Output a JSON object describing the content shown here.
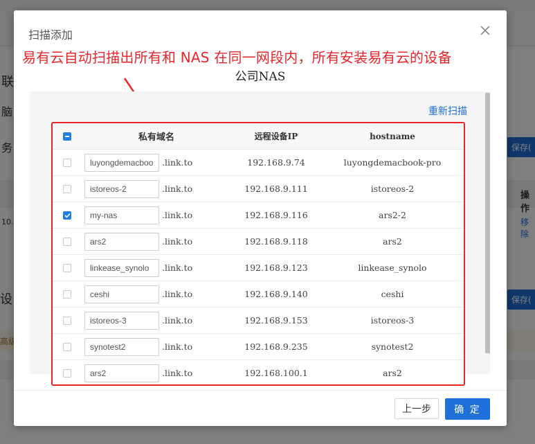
{
  "background": {
    "heading_partial": "联",
    "label_partial_1": "脑",
    "label_partial_2": "务：",
    "save_button_partial": "保存(",
    "col_header_partial": "操作",
    "row_link_partial": "移除",
    "row_ip_partial": "10.",
    "section_partial": "设（",
    "advanced_partial": "高级"
  },
  "modal": {
    "title": "扫描添加",
    "annotation": "易有云自动扫描出所有和 NAS 在同一网段内，所有安装易有云的设备",
    "device_name": "公司NAS",
    "rescan_label": "重新扫描",
    "columns": {
      "domain": "私有域名",
      "ip": "远程设备IP",
      "hostname": "hostname"
    },
    "domain_suffix": ".link.to",
    "rows": [
      {
        "domain": "luyongdemacboo",
        "ip": "192.168.9.74",
        "hostname": "luyongdemacbook-pro",
        "checked": false
      },
      {
        "domain": "istoreos-2",
        "ip": "192.168.9.111",
        "hostname": "istoreos-2",
        "checked": false
      },
      {
        "domain": "my-nas",
        "ip": "192.168.9.116",
        "hostname": "ars2-2",
        "checked": true
      },
      {
        "domain": "ars2",
        "ip": "192.168.9.118",
        "hostname": "ars2",
        "checked": false
      },
      {
        "domain": "linkease_synolo",
        "ip": "192.168.9.123",
        "hostname": "linkease_synolo",
        "checked": false
      },
      {
        "domain": "ceshi",
        "ip": "192.168.9.140",
        "hostname": "ceshi",
        "checked": false
      },
      {
        "domain": "istoreos-3",
        "ip": "192.168.9.153",
        "hostname": "istoreos-3",
        "checked": false
      },
      {
        "domain": "synotest2",
        "ip": "192.168.9.235",
        "hostname": "synotest2",
        "checked": false
      },
      {
        "domain": "ars2",
        "ip": "192.168.100.1",
        "hostname": "ars2",
        "checked": false
      }
    ],
    "prev_label": "上一步",
    "ok_label": "确 定"
  },
  "colors": {
    "accent": "#1e6fd9",
    "annotation_red": "#e8262a",
    "checkbox_blue": "#1e80e5"
  }
}
